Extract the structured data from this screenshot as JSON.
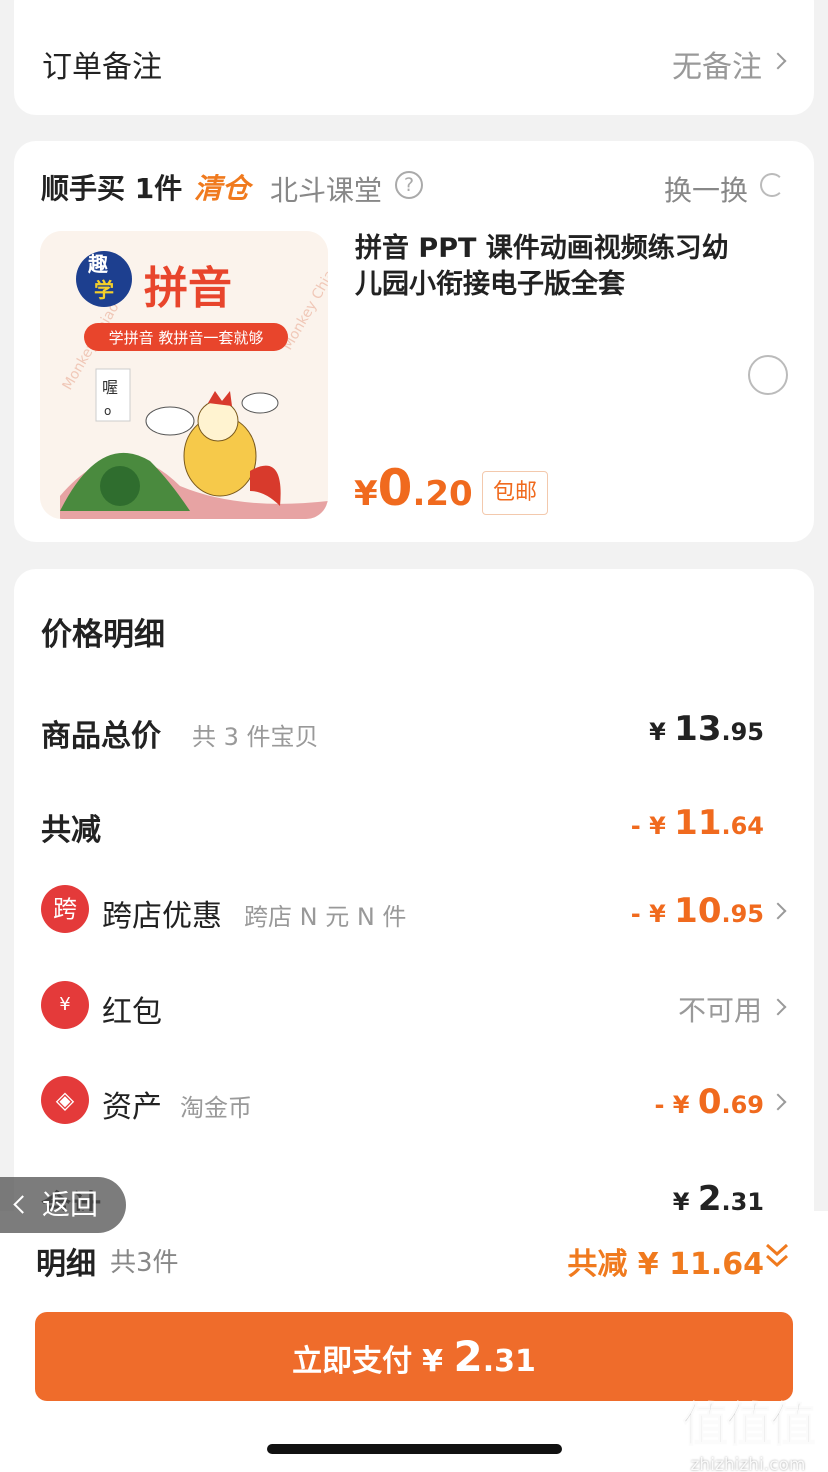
{
  "note": {
    "label": "订单备注",
    "value": "无备注"
  },
  "addon": {
    "title": "顺手买 1件",
    "tag": "清仓",
    "shop": "北斗课堂",
    "swap_label": "换一换",
    "product": {
      "name": "拼音 PPT 课件动画视频练习幼儿园小衔接电子版全套",
      "image_title": "拼音",
      "image_badge": "趣学",
      "image_banner": "学拼音 教拼音一套就够",
      "image_card_char": "喔",
      "image_card_pinyin": "o",
      "image_watermark": "Monkey Chiao",
      "price_yen": "¥",
      "price_int": "0",
      "price_dec": ".20",
      "shipping": "包邮"
    }
  },
  "detail": {
    "title": "价格明细",
    "rows": [
      {
        "label": "商品总价",
        "sub": "共 3 件宝贝",
        "prefix": "¥ ",
        "int": "13",
        "dec": ".95"
      },
      {
        "label": "共减",
        "prefix": "- ¥ ",
        "int": "11",
        "dec": ".64"
      },
      {
        "label": "跨店优惠",
        "icon_text": "跨",
        "sub": "跨店 N 元 N 件",
        "prefix": "- ¥ ",
        "int": "10",
        "dec": ".95"
      },
      {
        "label": "红包",
        "icon_text": "¥",
        "value": "不可用"
      },
      {
        "label": "资产",
        "sub": "淘金币",
        "prefix": "- ¥ ",
        "int": "0",
        "dec": ".69"
      },
      {
        "label": "合计",
        "prefix": "¥ ",
        "int": "2",
        "dec": ".31"
      }
    ]
  },
  "back": {
    "label": "返回"
  },
  "bottom": {
    "label": "明细",
    "count": "共3件",
    "discount": "共减 ¥ 11.64",
    "pay_label": "立即支付",
    "pay_yen": "¥ ",
    "pay_int": "2",
    "pay_dec": ".31"
  },
  "watermark": {
    "logo": "值值值",
    "site": "zhizhizhi.com"
  },
  "colors": {
    "accent": "#ef6c2b",
    "price": "#f06a1e",
    "icon_red": "#e43a3a"
  }
}
